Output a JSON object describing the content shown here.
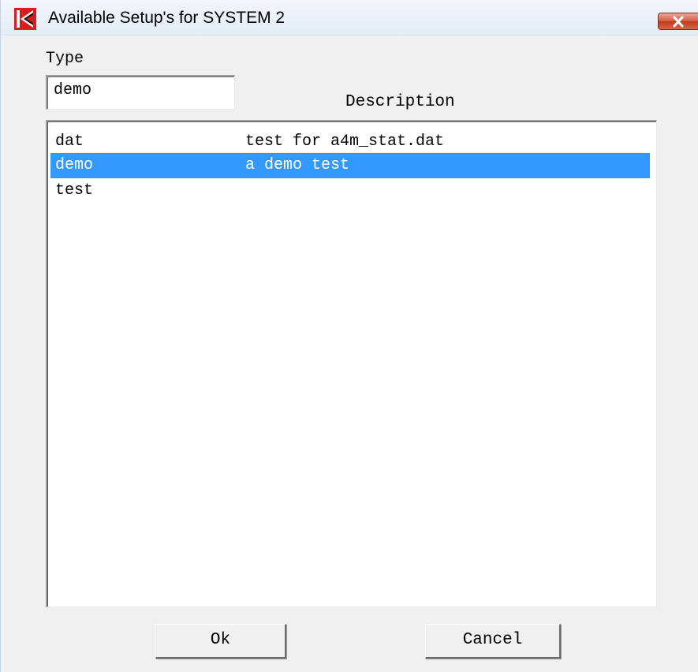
{
  "window": {
    "title": "Available Setup's for SYSTEM 2",
    "icon": "app-logo-icon",
    "close_icon": "close-icon",
    "close_color": "#c8462a"
  },
  "form": {
    "type_label": "Type",
    "type_value": "demo",
    "description_label": "Description"
  },
  "list": {
    "selection_color": "#3399ff",
    "rows": [
      {
        "type": "dat",
        "description": "test for a4m_stat.dat",
        "selected": false
      },
      {
        "type": "demo",
        "description": "a demo test",
        "selected": true
      },
      {
        "type": "test",
        "description": "",
        "selected": false
      }
    ]
  },
  "buttons": {
    "ok_label": "Ok",
    "cancel_label": "Cancel"
  }
}
